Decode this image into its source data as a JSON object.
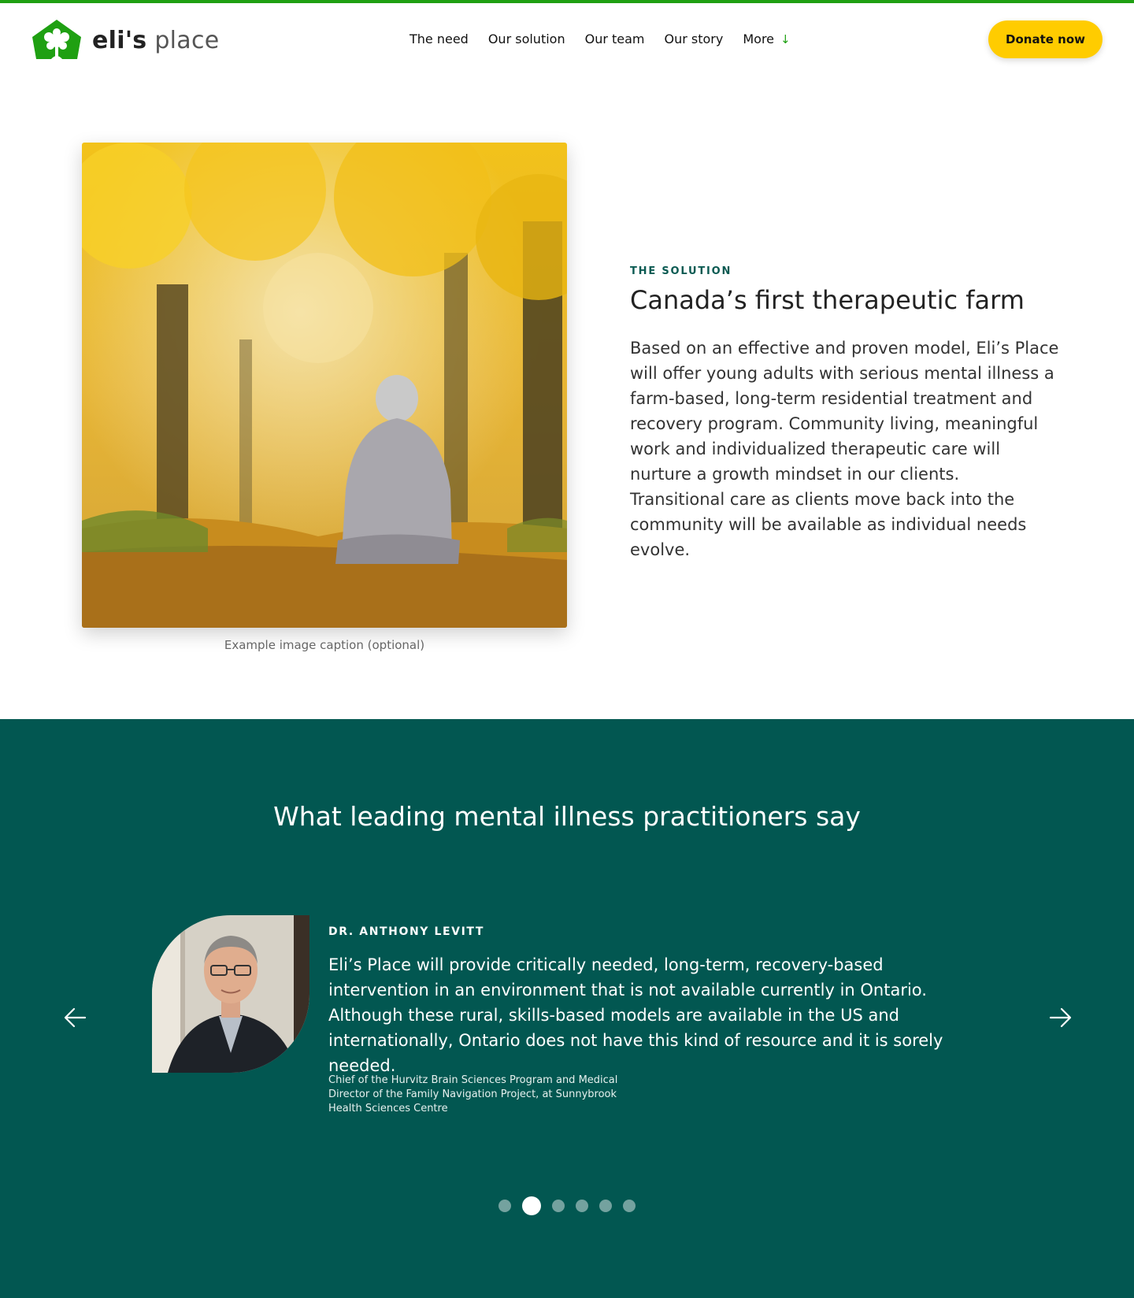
{
  "brand": {
    "name_bold": "eli's",
    "name_light": "place",
    "accent": "#1fa012"
  },
  "nav": {
    "items": [
      {
        "label": "The need"
      },
      {
        "label": "Our solution"
      },
      {
        "label": "Our team"
      },
      {
        "label": "Our story"
      },
      {
        "label": "More",
        "icon": "arrow-down-icon"
      }
    ],
    "donate_label": "Donate now",
    "donate_color": "#ffcc00"
  },
  "solution": {
    "image_caption": "Example image caption (optional)",
    "eyebrow": "THE SOLUTION",
    "title": "Canada’s first therapeutic farm",
    "body": "Based on an effective and proven model, Eli’s Place will offer young adults with serious mental illness a farm-based, long-term residential treatment and recovery program. Community living, meaningful work and individualized therapeutic care will nurture a growth mindset in our clients. Transitional care as clients move back into the community will be available as individual needs evolve."
  },
  "testimonials": {
    "background": "#025751",
    "heading": "What leading mental illness practitioners say",
    "current": {
      "name": "DR. ANTHONY LEVITT",
      "quote": "Eli’s Place will provide critically needed, long-term, recovery-based intervention in an environment that is not available currently in Ontario. Although these rural, skills-based models are available in the US and internationally, Ontario does not have this kind of resource and it is sorely needed.",
      "role": "Chief of the Hurvitz Brain Sciences Program and Medical Director of the Family Navigation Project, at Sunnybrook Health Sciences Centre"
    },
    "prev_icon": "arrow-left-icon",
    "next_icon": "arrow-right-icon",
    "slide_count": 6,
    "active_slide": 2
  }
}
